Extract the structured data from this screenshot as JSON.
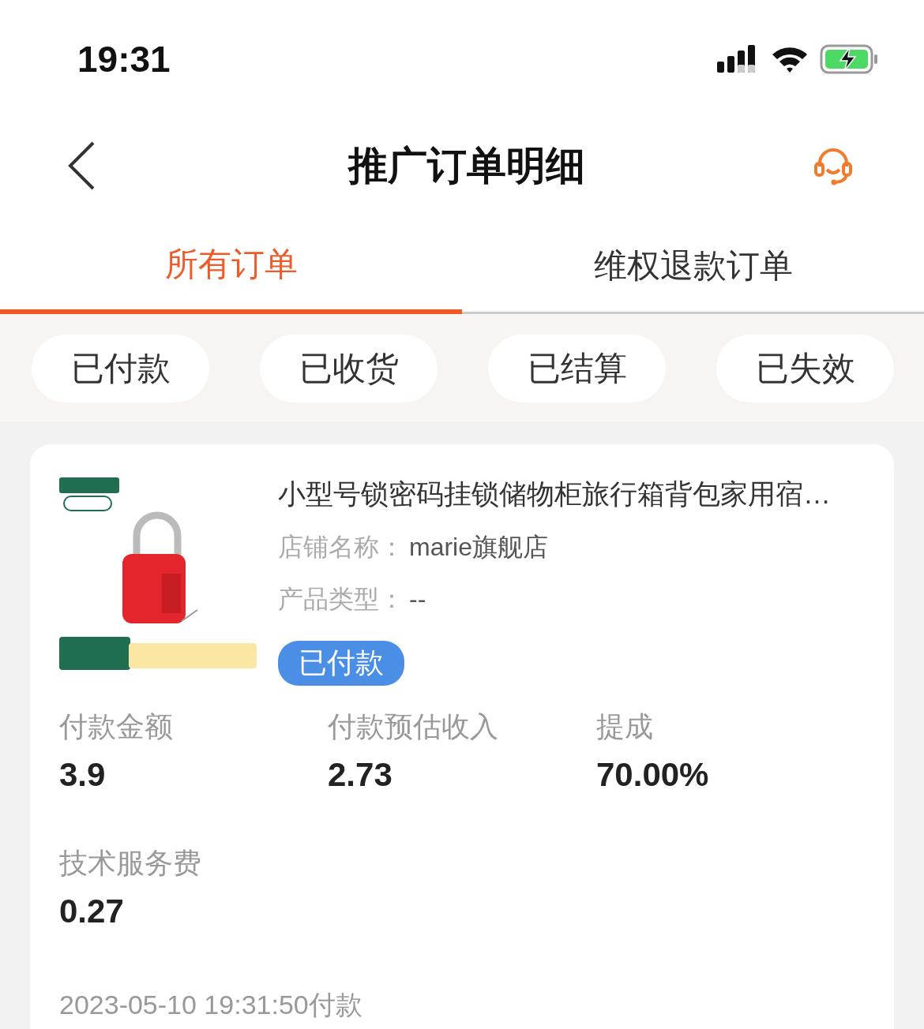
{
  "status_bar": {
    "time": "19:31"
  },
  "header": {
    "title": "推广订单明细"
  },
  "tabs": [
    {
      "label": "所有订单",
      "selected": true
    },
    {
      "label": "维权退款订单",
      "selected": false
    }
  ],
  "filters": [
    {
      "label": "已付款"
    },
    {
      "label": "已收货"
    },
    {
      "label": "已结算"
    },
    {
      "label": "已失效"
    }
  ],
  "order": {
    "title": "小型号锁密码挂锁储物柜旅行箱背包家用宿…",
    "shop_label": "店铺名称：",
    "shop": "marie旗舰店",
    "type_label": "产品类型：",
    "type": "--",
    "status": "已付款",
    "metrics": [
      {
        "label": "付款金额",
        "value": "3.9"
      },
      {
        "label": "付款预估收入",
        "value": "2.73"
      },
      {
        "label": "提成",
        "value": "70.00%"
      },
      {
        "label": "技术服务费",
        "value": "0.27"
      }
    ],
    "time": "2023-05-10 19:31:50付款"
  }
}
